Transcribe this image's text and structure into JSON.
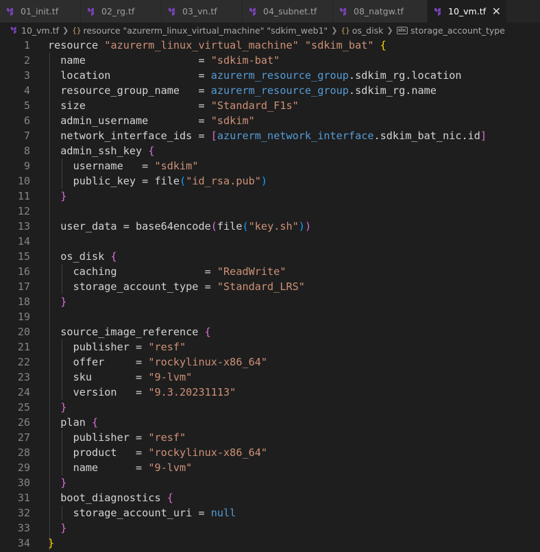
{
  "tabs": [
    {
      "label": "01_init.tf",
      "active": false
    },
    {
      "label": "02_rg.tf",
      "active": false
    },
    {
      "label": "03_vn.tf",
      "active": false
    },
    {
      "label": "04_subnet.tf",
      "active": false
    },
    {
      "label": "08_natgw.tf",
      "active": false
    },
    {
      "label": "10_vm.tf",
      "active": true
    }
  ],
  "breadcrumb": {
    "file": "10_vm.tf",
    "resource": "resource \"azurerm_linux_virtual_machine\" \"sdkim_web1\"",
    "block": "os_disk",
    "attribute": "storage_account_type"
  },
  "colors": {
    "terraform_icon": "#7b42bc",
    "string": "#ce9178",
    "reference": "#569cd6",
    "bracket_level1": "#ffd700",
    "bracket_level2": "#da70d6",
    "bracket_level3": "#179fff"
  },
  "editor": {
    "lines": [
      {
        "n": "1",
        "tokens": [
          [
            "kw",
            "resource "
          ],
          [
            "str",
            "\"azurerm_linux_virtual_machine\""
          ],
          [
            "id",
            " "
          ],
          [
            "str",
            "\"sdkim_bat\""
          ],
          [
            "id",
            " "
          ],
          [
            "b1",
            "{"
          ]
        ]
      },
      {
        "n": "2",
        "tokens": [
          [
            "id",
            "  name                  = "
          ],
          [
            "str",
            "\"sdkim-bat\""
          ]
        ]
      },
      {
        "n": "3",
        "tokens": [
          [
            "id",
            "  location              = "
          ],
          [
            "ref",
            "azurerm_resource_group"
          ],
          [
            "id",
            ".sdkim_rg.location"
          ]
        ]
      },
      {
        "n": "4",
        "tokens": [
          [
            "id",
            "  resource_group_name   = "
          ],
          [
            "ref",
            "azurerm_resource_group"
          ],
          [
            "id",
            ".sdkim_rg.name"
          ]
        ]
      },
      {
        "n": "5",
        "tokens": [
          [
            "id",
            "  size                  = "
          ],
          [
            "str",
            "\"Standard_F1s\""
          ]
        ]
      },
      {
        "n": "6",
        "tokens": [
          [
            "id",
            "  admin_username        = "
          ],
          [
            "str",
            "\"sdkim\""
          ]
        ]
      },
      {
        "n": "7",
        "tokens": [
          [
            "id",
            "  network_interface_ids = "
          ],
          [
            "b2",
            "["
          ],
          [
            "ref",
            "azurerm_network_interface"
          ],
          [
            "id",
            ".sdkim_bat_nic.id"
          ],
          [
            "b2",
            "]"
          ]
        ]
      },
      {
        "n": "8",
        "tokens": [
          [
            "id",
            "  admin_ssh_key "
          ],
          [
            "b2",
            "{"
          ]
        ]
      },
      {
        "n": "9",
        "tokens": [
          [
            "id",
            "    username   = "
          ],
          [
            "str",
            "\"sdkim\""
          ]
        ]
      },
      {
        "n": "10",
        "tokens": [
          [
            "id",
            "    public_key = file"
          ],
          [
            "b3",
            "("
          ],
          [
            "str",
            "\"id_rsa.pub\""
          ],
          [
            "b3",
            ")"
          ]
        ]
      },
      {
        "n": "11",
        "tokens": [
          [
            "id",
            "  "
          ],
          [
            "b2",
            "}"
          ]
        ]
      },
      {
        "n": "12",
        "tokens": []
      },
      {
        "n": "13",
        "tokens": [
          [
            "id",
            "  user_data = base64encode"
          ],
          [
            "b2",
            "("
          ],
          [
            "id",
            "file"
          ],
          [
            "b3",
            "("
          ],
          [
            "str",
            "\"key.sh\""
          ],
          [
            "b3",
            ")"
          ],
          [
            "b2",
            ")"
          ]
        ]
      },
      {
        "n": "14",
        "tokens": []
      },
      {
        "n": "15",
        "tokens": [
          [
            "id",
            "  os_disk "
          ],
          [
            "b2",
            "{"
          ]
        ]
      },
      {
        "n": "16",
        "tokens": [
          [
            "id",
            "    caching              = "
          ],
          [
            "str",
            "\"ReadWrite\""
          ]
        ]
      },
      {
        "n": "17",
        "tokens": [
          [
            "id",
            "    storage_account_type = "
          ],
          [
            "str",
            "\"Standard_LRS\""
          ]
        ]
      },
      {
        "n": "18",
        "tokens": [
          [
            "id",
            "  "
          ],
          [
            "b2",
            "}"
          ]
        ]
      },
      {
        "n": "19",
        "tokens": []
      },
      {
        "n": "20",
        "tokens": [
          [
            "id",
            "  source_image_reference "
          ],
          [
            "b2",
            "{"
          ]
        ]
      },
      {
        "n": "21",
        "tokens": [
          [
            "id",
            "    publisher = "
          ],
          [
            "str",
            "\"resf\""
          ]
        ]
      },
      {
        "n": "22",
        "tokens": [
          [
            "id",
            "    offer     = "
          ],
          [
            "str",
            "\"rockylinux-x86_64\""
          ]
        ]
      },
      {
        "n": "23",
        "tokens": [
          [
            "id",
            "    sku       = "
          ],
          [
            "str",
            "\"9-lvm\""
          ]
        ]
      },
      {
        "n": "24",
        "tokens": [
          [
            "id",
            "    version   = "
          ],
          [
            "str",
            "\"9.3.20231113\""
          ]
        ]
      },
      {
        "n": "25",
        "tokens": [
          [
            "id",
            "  "
          ],
          [
            "b2",
            "}"
          ]
        ]
      },
      {
        "n": "26",
        "tokens": [
          [
            "id",
            "  plan "
          ],
          [
            "b2",
            "{"
          ]
        ]
      },
      {
        "n": "27",
        "tokens": [
          [
            "id",
            "    publisher = "
          ],
          [
            "str",
            "\"resf\""
          ]
        ]
      },
      {
        "n": "28",
        "tokens": [
          [
            "id",
            "    product   = "
          ],
          [
            "str",
            "\"rockylinux-x86_64\""
          ]
        ]
      },
      {
        "n": "29",
        "tokens": [
          [
            "id",
            "    name      = "
          ],
          [
            "str",
            "\"9-lvm\""
          ]
        ]
      },
      {
        "n": "30",
        "tokens": [
          [
            "id",
            "  "
          ],
          [
            "b2",
            "}"
          ]
        ]
      },
      {
        "n": "31",
        "tokens": [
          [
            "id",
            "  boot_diagnostics "
          ],
          [
            "b2",
            "{"
          ]
        ]
      },
      {
        "n": "32",
        "tokens": [
          [
            "id",
            "    storage_account_uri = "
          ],
          [
            "null",
            "null"
          ]
        ]
      },
      {
        "n": "33",
        "tokens": [
          [
            "id",
            "  "
          ],
          [
            "b2",
            "}"
          ]
        ]
      },
      {
        "n": "34",
        "tokens": [
          [
            "b1",
            "}"
          ]
        ]
      }
    ]
  }
}
